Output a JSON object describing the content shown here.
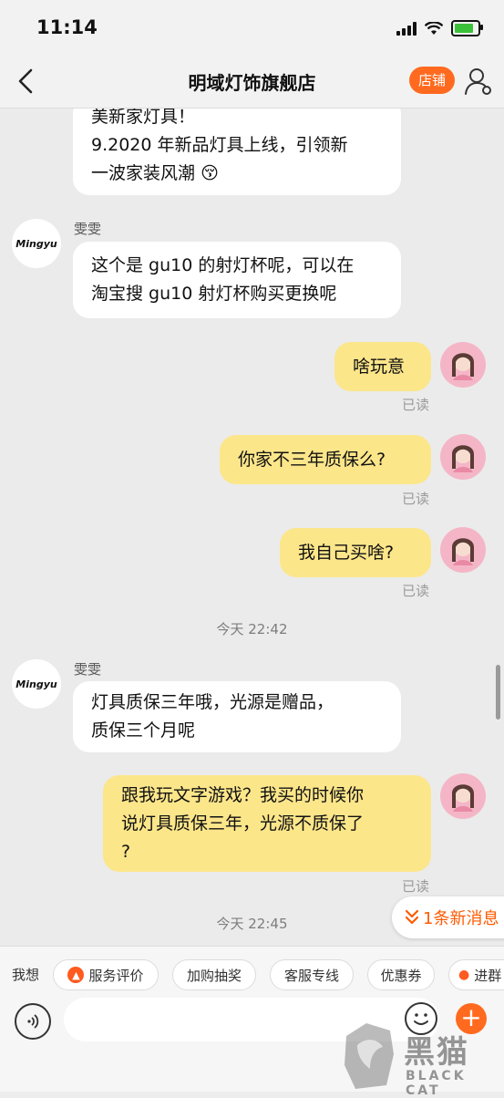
{
  "status": {
    "time": "11:14"
  },
  "nav": {
    "title": "明域灯饰旗舰店",
    "store_button": "店铺"
  },
  "shop_avatar_text": "Mingyu",
  "messages": {
    "m1_lines": [
      "美新家灯具！",
      "9.2020 年新品灯具上线，引领新",
      "一波家装风潮"
    ],
    "m1_emoji": "😚",
    "sender1": "雯雯",
    "m2_lines": [
      "这个是 gu10 的射灯杯呢，可以在",
      "淘宝搜 gu10 射灯杯购买更换呢"
    ],
    "m3": "啥玩意",
    "m4": "你家不三年质保么?",
    "m5": "我自己买啥?",
    "read": "已读",
    "time1": "今天 22:42",
    "sender2": "雯雯",
    "m6_lines": [
      "灯具质保三年哦，光源是赠品，",
      "质保三个月呢"
    ],
    "m7_lines": [
      "跟我玩文字游戏？我买的时候你",
      "说灯具质保三年，光源不质保了",
      "?"
    ],
    "time2": "今天 22:45",
    "new_message": "1条新消息"
  },
  "quickbar": {
    "label": "我想",
    "chips": [
      "服务评价",
      "加购抽奖",
      "客服专线",
      "优惠券",
      "进群"
    ]
  },
  "input": {
    "placeholder": ""
  },
  "watermark": {
    "main": "黑猫",
    "sub": "BLACK CAT"
  },
  "colors": {
    "accent": "#ff6a1f",
    "bubble_self": "#fce68a",
    "bubble_other": "#ffffff"
  }
}
